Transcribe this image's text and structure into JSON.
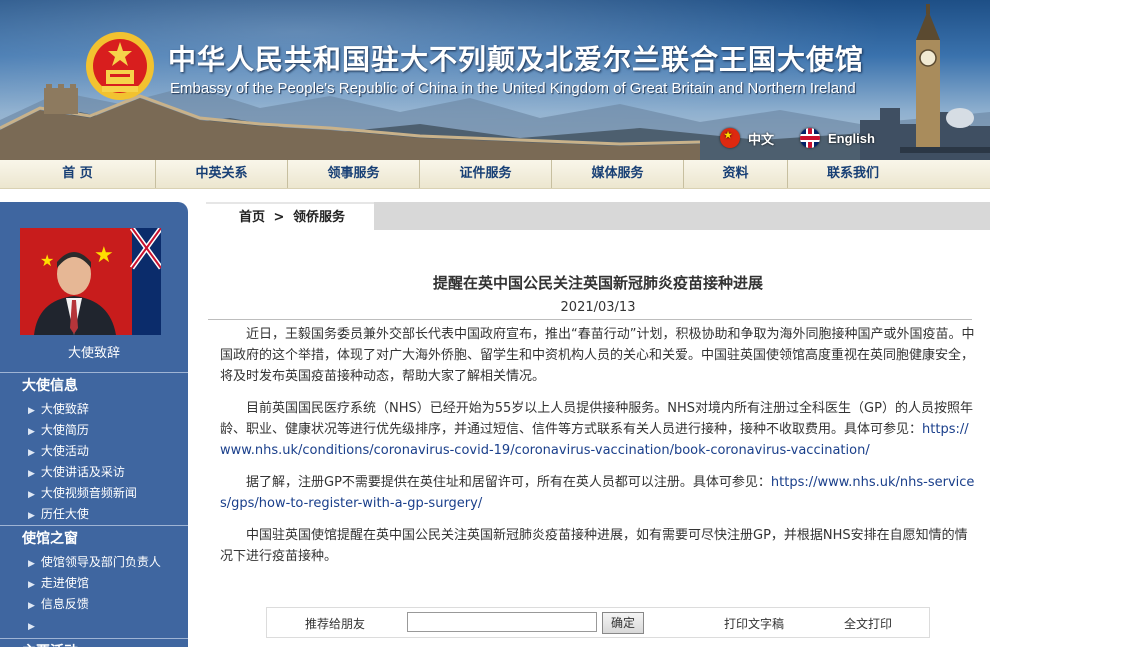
{
  "header": {
    "title_cn": "中华人民共和国驻大不列颠及北爱尔兰联合王国大使馆",
    "title_en": "Embassy of the People's Republic of China in the United Kingdom of Great Britain and Northern Ireland",
    "lang_cn": "中文",
    "lang_en": "English"
  },
  "nav": {
    "items": [
      {
        "label": "首  页"
      },
      {
        "label": "中英关系"
      },
      {
        "label": "领事服务"
      },
      {
        "label": "证件服务"
      },
      {
        "label": "媒体服务"
      },
      {
        "label": "资料"
      },
      {
        "label": "联系我们"
      }
    ]
  },
  "sidebar": {
    "ambassador_caption": "大使致辞",
    "sections": [
      {
        "title": "大使信息",
        "items": [
          "大使致辞",
          "大使简历",
          "大使活动",
          "大使讲话及采访",
          "大使视频音频新闻",
          "历任大使"
        ]
      },
      {
        "title": "使馆之窗",
        "items": [
          "使馆领导及部门负责人",
          "走进使馆",
          "信息反馈",
          ""
        ]
      },
      {
        "title": "主要活动"
      }
    ]
  },
  "breadcrumb": {
    "home": "首页",
    "sep": ">",
    "current": "领侨服务"
  },
  "article": {
    "title": "提醒在英中国公民关注英国新冠肺炎疫苗接种进展",
    "date": "2021/03/13",
    "p1": "近日，王毅国务委员兼外交部长代表中国政府宣布，推出“春苗行动”计划，积极协助和争取为海外同胞接种国产或外国疫苗。中国政府的这个举措，体现了对广大海外侨胞、留学生和中资机构人员的关心和关爱。中国驻英国使领馆高度重视在英同胞健康安全，将及时发布英国疫苗接种动态，帮助大家了解相关情况。",
    "p2_text": "目前英国国民医疗系统（NHS）已经开始为55岁以上人员提供接种服务。NHS对境内所有注册过全科医生（GP）的人员按照年龄、职业、健康状况等进行优先级排序，并通过短信、信件等方式联系有关人员进行接种，接种不收取费用。具体可参见：",
    "p2_link": "https://www.nhs.uk/conditions/coronavirus-covid-19/coronavirus-vaccination/book-coronavirus-vaccination/",
    "p3_text": "据了解，注册GP不需要提供在英住址和居留许可，所有在英人员都可以注册。具体可参见：",
    "p3_link": "https://www.nhs.uk/nhs-services/gps/how-to-register-with-a-gp-surgery/",
    "p4": "中国驻英国使馆提醒在英中国公民关注英国新冠肺炎疫苗接种进展，如有需要可尽快注册GP，并根据NHS安排在自愿知情的情况下进行疫苗接种。"
  },
  "footer": {
    "recommend_label": "推荐给朋友",
    "recommend_value": "",
    "confirm": "确定",
    "print_text": "打印文字稿",
    "print_full": "全文打印"
  }
}
